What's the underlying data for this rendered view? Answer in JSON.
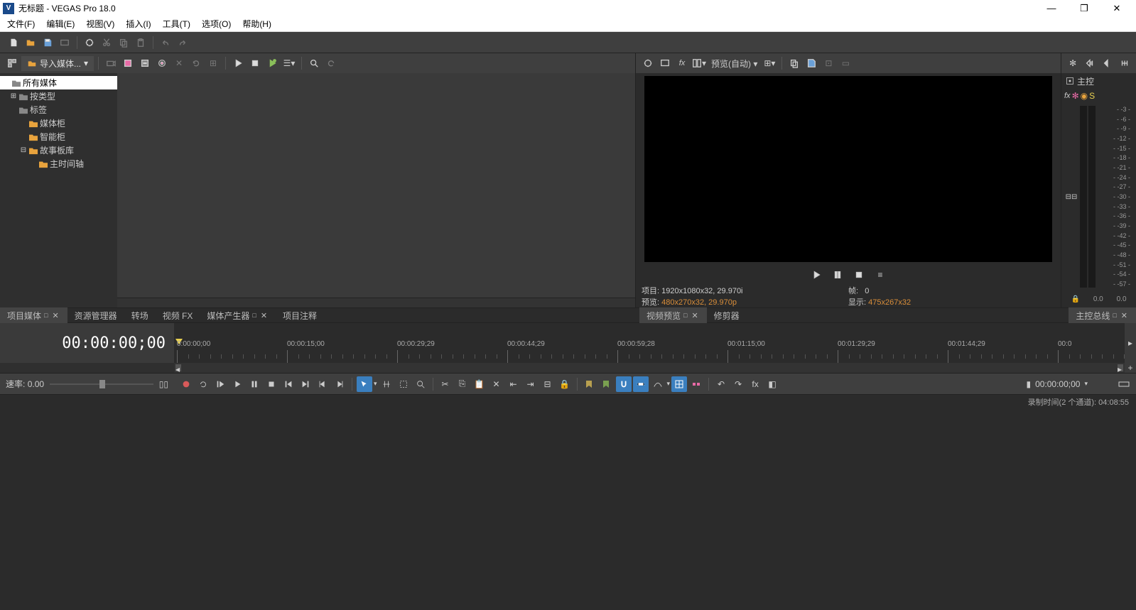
{
  "title": "无标题 - VEGAS Pro 18.0",
  "appShort": "V",
  "menu": [
    "文件(F)",
    "编辑(E)",
    "视图(V)",
    "插入(I)",
    "工具(T)",
    "选项(O)",
    "帮助(H)"
  ],
  "mediaToolbar": {
    "import": "导入媒体..."
  },
  "tree": {
    "all": "所有媒体",
    "byType": "按类型",
    "tags": "标签",
    "bins": "媒体柜",
    "smart": "智能柜",
    "story": "故事板库",
    "mainTimeline": "主时间轴"
  },
  "previewToolbar": {
    "quality": "预览(自动)"
  },
  "previewInfo": {
    "projectLabel": "项目:",
    "projectValue": "1920x1080x32, 29.970i",
    "previewLabel": "预览:",
    "previewValue": "480x270x32, 29.970p",
    "frameLabel": "帧:",
    "frameValue": "0",
    "displayLabel": "显示:",
    "displayValue": "475x267x32"
  },
  "master": {
    "title": "主控",
    "scale": [
      "-3",
      "-6",
      "-9",
      "-12",
      "-15",
      "-18",
      "-21",
      "-24",
      "-27",
      "-30",
      "-33",
      "-36",
      "-39",
      "-42",
      "-45",
      "-48",
      "-51",
      "-54",
      "-57"
    ],
    "foot": [
      "0.0",
      "0.0"
    ]
  },
  "tabsLeft": [
    "项目媒体",
    "资源管理器",
    "转场",
    "视频 FX",
    "媒体产生器",
    "项目注释"
  ],
  "tabsRight": [
    "视频预览",
    "修剪器"
  ],
  "tabMaster": "主控总线",
  "timecode": "00:00:00;00",
  "ruler": [
    "0:00:00;00",
    "00:00:15;00",
    "00:00:29;29",
    "00:00:44;29",
    "00:00:59;28",
    "00:01:15;00",
    "00:01:29;29",
    "00:01:44;29",
    "00:0"
  ],
  "rate": {
    "label": "速率:",
    "value": "0.00"
  },
  "bottomTC": "00:00:00;00",
  "status": "录制时间(2 个通道): 04:08:55"
}
